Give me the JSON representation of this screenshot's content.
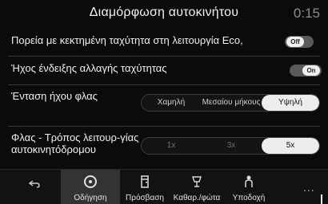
{
  "header": {
    "title": "Διαμόρφωση αυτοκινήτου",
    "time": "0:15"
  },
  "settings": [
    {
      "label": "Πορεία με κεκτημένη ταχύτητα στη λειτουργία Eco,",
      "control": "toggle",
      "state_text": "Off"
    },
    {
      "label": "Ήχος ένδειξης αλλαγής ταχύτητας",
      "control": "toggle",
      "state_text": "On"
    },
    {
      "label": "Ένταση ήχου φλας",
      "control": "segmented",
      "options": [
        "Χαμηλή",
        "Μεσαίου μήκους",
        "Υψηλή"
      ],
      "selected": "Υψηλή"
    },
    {
      "label": "Φλας - Τρόπος λειτουρ-γίας αυτοκινητόδρομου",
      "control": "segmented",
      "options": [
        "1x",
        "3x",
        "5x"
      ],
      "selected": "5x"
    }
  ],
  "tabs": [
    {
      "label": "Οδήγηση",
      "icon": "steering-wheel-icon",
      "active": true
    },
    {
      "label": "Πρόσβαση",
      "icon": "car-door-icon",
      "active": false
    },
    {
      "label": "Καθαρ./φώτα",
      "icon": "wiper-light-icon",
      "active": false
    },
    {
      "label": "Υποδοχή",
      "icon": "welcome-person-icon",
      "active": false
    }
  ],
  "navigation": {
    "back_icon": "back-arrow-icon",
    "more_icon": "more-options-icon",
    "more_text": "..."
  }
}
